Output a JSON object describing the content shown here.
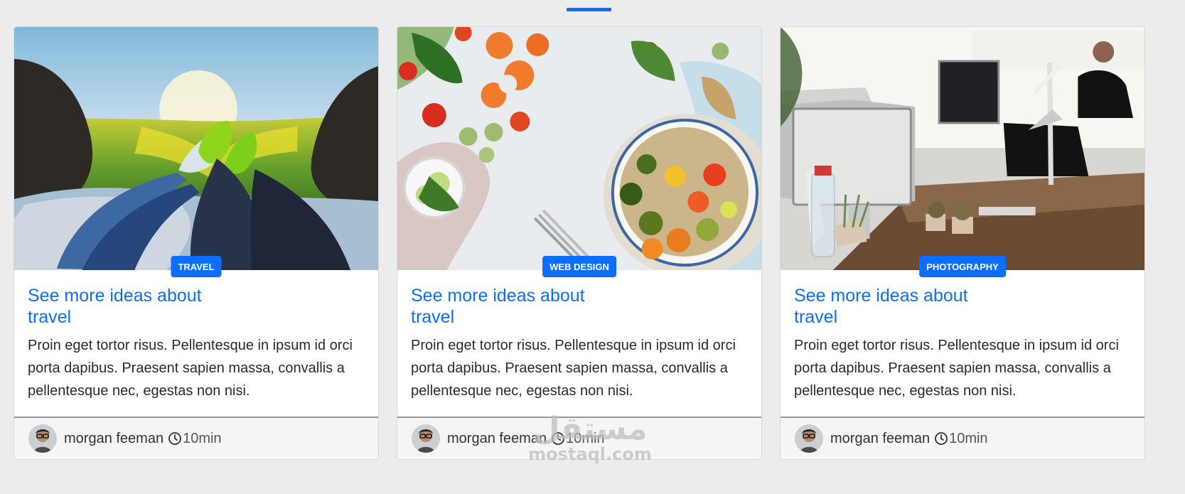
{
  "cards": [
    {
      "image": "travel-photo",
      "category": "TRAVEL",
      "title": "See more ideas about travel",
      "text": "Proin eget tortor risus. Pellentesque in ipsum id orci porta dapibus. Praesent sapien massa, convallis a pellentesque nec, egestas non nisi.",
      "author": "morgan feeman",
      "time": "10min"
    },
    {
      "image": "food-photo",
      "category": "WEB DESIGN",
      "title": "See more ideas about travel",
      "text": "Proin eget tortor risus. Pellentesque in ipsum id orci porta dapibus. Praesent sapien massa, convallis a pellentesque nec, egestas non nisi.",
      "author": "morgan feeman",
      "time": "10min"
    },
    {
      "image": "office-photo",
      "category": "PHOTOGRAPHY",
      "title": "See more ideas about travel",
      "text": "Proin eget tortor risus. Pellentesque in ipsum id orci porta dapibus. Praesent sapien massa, convallis a pellentesque nec, egestas non nisi.",
      "author": "morgan feeman",
      "time": "10min"
    }
  ],
  "watermark": {
    "arabic": "مستقل",
    "site": "mostaql.com"
  },
  "colors": {
    "accent": "#0d6efd",
    "page_background": "#ececec"
  }
}
